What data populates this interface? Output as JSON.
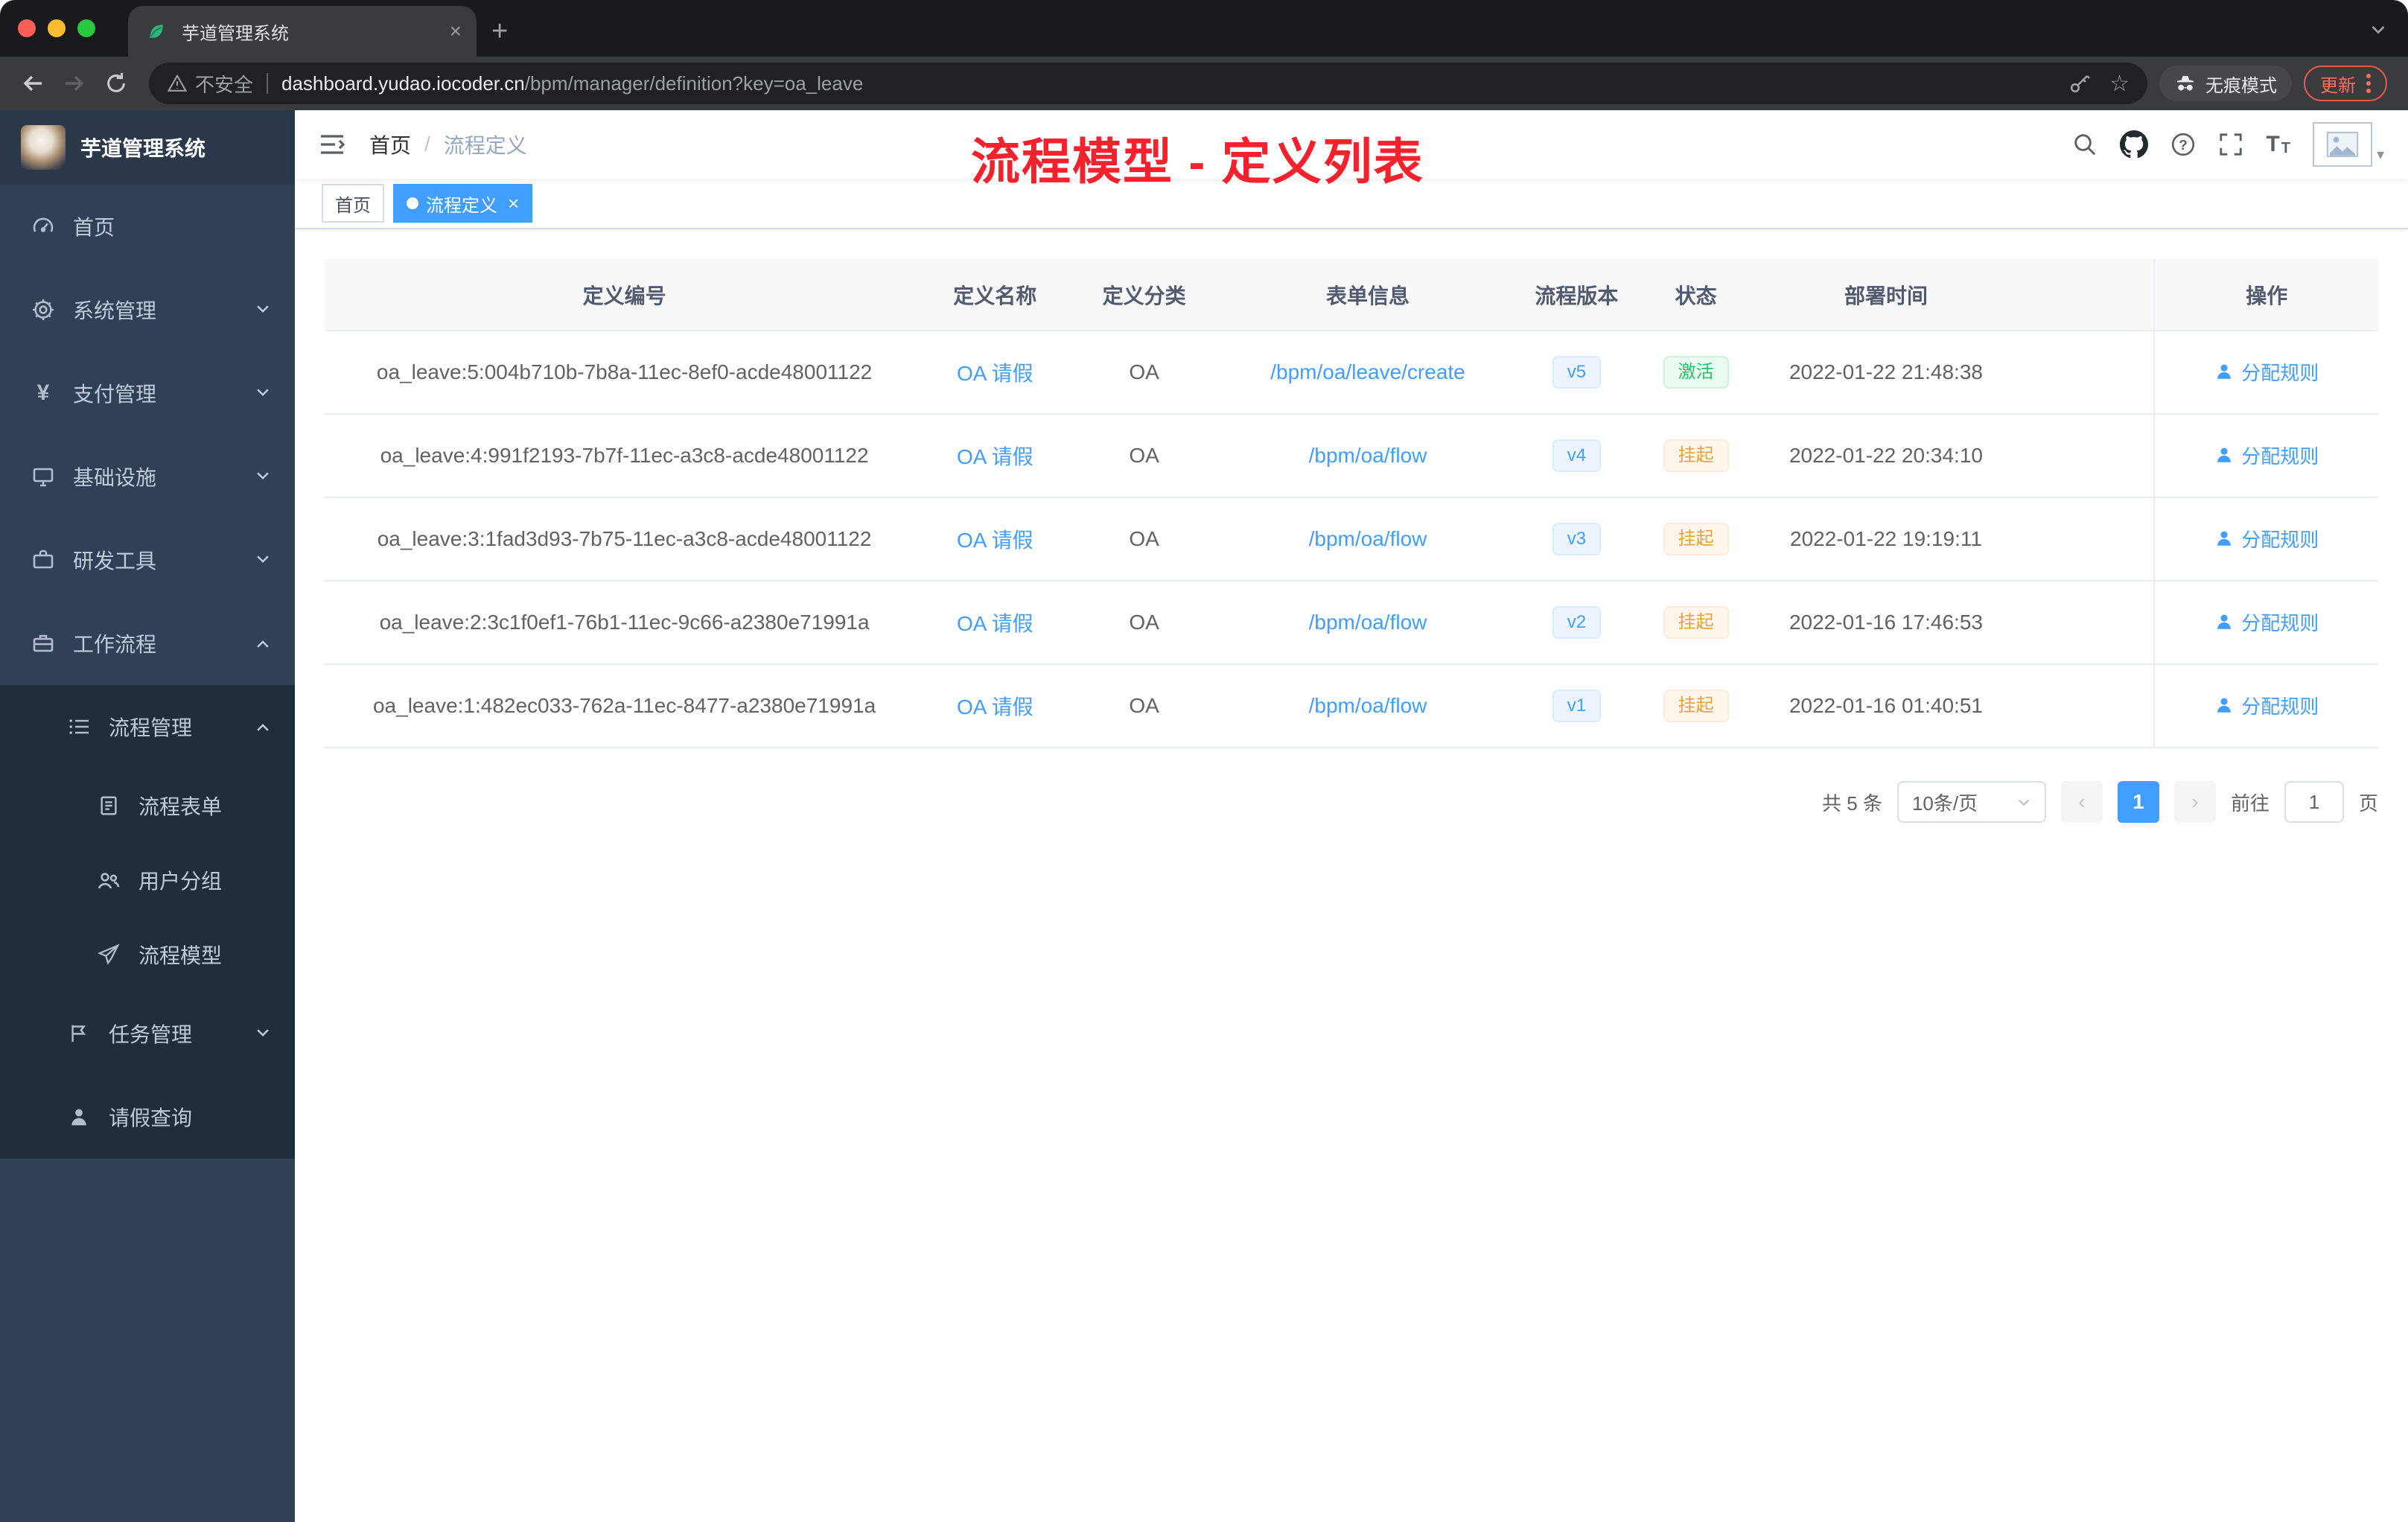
{
  "browser": {
    "tab_title": "芋道管理系统",
    "security_label": "不安全",
    "url_host": "dashboard.yudao.iocoder.cn",
    "url_path": "/bpm/manager/definition?key=oa_leave",
    "incognito_label": "无痕模式",
    "update_label": "更新"
  },
  "sidebar": {
    "logo_title": "芋道管理系统",
    "items": [
      {
        "label": "首页"
      },
      {
        "label": "系统管理"
      },
      {
        "label": "支付管理"
      },
      {
        "label": "基础设施"
      },
      {
        "label": "研发工具"
      },
      {
        "label": "工作流程"
      },
      {
        "label": "流程管理"
      },
      {
        "label": "流程表单"
      },
      {
        "label": "用户分组"
      },
      {
        "label": "流程模型"
      },
      {
        "label": "任务管理"
      },
      {
        "label": "请假查询"
      }
    ]
  },
  "header": {
    "breadcrumb": {
      "home": "首页",
      "separator": "/",
      "current": "流程定义"
    }
  },
  "annotation": {
    "text": "流程模型 - 定义列表",
    "color": "#f5222d"
  },
  "tags": {
    "home": "首页",
    "active": "流程定义"
  },
  "table": {
    "columns": [
      "定义编号",
      "定义名称",
      "定义分类",
      "表单信息",
      "流程版本",
      "状态",
      "部署时间",
      "操作"
    ],
    "rows": [
      {
        "id": "oa_leave:5:004b710b-7b8a-11ec-8ef0-acde48001122",
        "name": "OA 请假",
        "category": "OA",
        "form": "/bpm/oa/leave/create",
        "version": "v5",
        "status": "激活",
        "status_type": "success",
        "deployed_at": "2022-01-22 21:48:38",
        "action": "分配规则"
      },
      {
        "id": "oa_leave:4:991f2193-7b7f-11ec-a3c8-acde48001122",
        "name": "OA 请假",
        "category": "OA",
        "form": "/bpm/oa/flow",
        "version": "v4",
        "status": "挂起",
        "status_type": "warning",
        "deployed_at": "2022-01-22 20:34:10",
        "action": "分配规则"
      },
      {
        "id": "oa_leave:3:1fad3d93-7b75-11ec-a3c8-acde48001122",
        "name": "OA 请假",
        "category": "OA",
        "form": "/bpm/oa/flow",
        "version": "v3",
        "status": "挂起",
        "status_type": "warning",
        "deployed_at": "2022-01-22 19:19:11",
        "action": "分配规则"
      },
      {
        "id": "oa_leave:2:3c1f0ef1-76b1-11ec-9c66-a2380e71991a",
        "name": "OA 请假",
        "category": "OA",
        "form": "/bpm/oa/flow",
        "version": "v2",
        "status": "挂起",
        "status_type": "warning",
        "deployed_at": "2022-01-16 17:46:53",
        "action": "分配规则"
      },
      {
        "id": "oa_leave:1:482ec033-762a-11ec-8477-a2380e71991a",
        "name": "OA 请假",
        "category": "OA",
        "form": "/bpm/oa/flow",
        "version": "v1",
        "status": "挂起",
        "status_type": "warning",
        "deployed_at": "2022-01-16 01:40:51",
        "action": "分配规则"
      }
    ]
  },
  "pagination": {
    "total": "共 5 条",
    "page_size": "10条/页",
    "current": "1",
    "goto_label": "前往",
    "goto_value": "1",
    "page_unit": "页"
  }
}
